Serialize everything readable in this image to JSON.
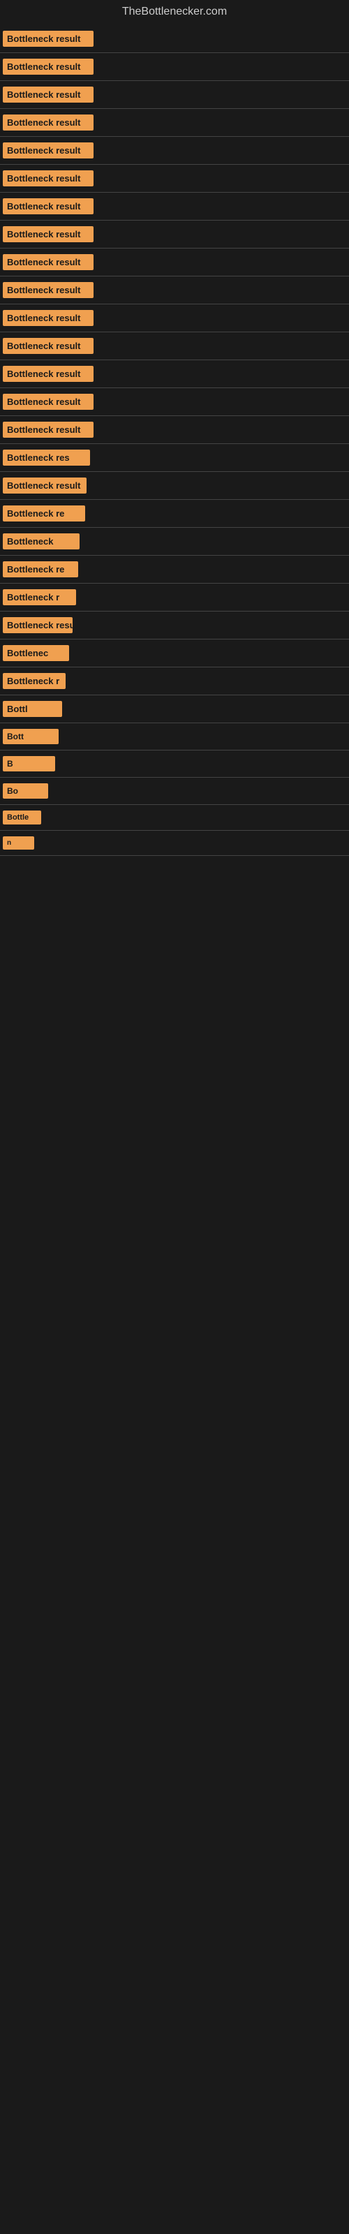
{
  "site": {
    "title": "TheBottlenecker.com"
  },
  "items": [
    {
      "id": 1,
      "label": "Bottleneck result",
      "width": 130
    },
    {
      "id": 2,
      "label": "Bottleneck result",
      "width": 130
    },
    {
      "id": 3,
      "label": "Bottleneck result",
      "width": 130
    },
    {
      "id": 4,
      "label": "Bottleneck result",
      "width": 130
    },
    {
      "id": 5,
      "label": "Bottleneck result",
      "width": 130
    },
    {
      "id": 6,
      "label": "Bottleneck result",
      "width": 130
    },
    {
      "id": 7,
      "label": "Bottleneck result",
      "width": 130
    },
    {
      "id": 8,
      "label": "Bottleneck result",
      "width": 130
    },
    {
      "id": 9,
      "label": "Bottleneck result",
      "width": 130
    },
    {
      "id": 10,
      "label": "Bottleneck result",
      "width": 130
    },
    {
      "id": 11,
      "label": "Bottleneck result",
      "width": 130
    },
    {
      "id": 12,
      "label": "Bottleneck result",
      "width": 130
    },
    {
      "id": 13,
      "label": "Bottleneck result",
      "width": 130
    },
    {
      "id": 14,
      "label": "Bottleneck result",
      "width": 130
    },
    {
      "id": 15,
      "label": "Bottleneck result",
      "width": 130
    },
    {
      "id": 16,
      "label": "Bottleneck res",
      "width": 125
    },
    {
      "id": 17,
      "label": "Bottleneck result",
      "width": 120
    },
    {
      "id": 18,
      "label": "Bottleneck re",
      "width": 118
    },
    {
      "id": 19,
      "label": "Bottleneck",
      "width": 110
    },
    {
      "id": 20,
      "label": "Bottleneck re",
      "width": 108
    },
    {
      "id": 21,
      "label": "Bottleneck r",
      "width": 105
    },
    {
      "id": 22,
      "label": "Bottleneck resu",
      "width": 100
    },
    {
      "id": 23,
      "label": "Bottlenec",
      "width": 95
    },
    {
      "id": 24,
      "label": "Bottleneck r",
      "width": 90
    },
    {
      "id": 25,
      "label": "Bottl",
      "width": 85
    },
    {
      "id": 26,
      "label": "Bott",
      "width": 80
    },
    {
      "id": 27,
      "label": "B",
      "width": 18
    },
    {
      "id": 28,
      "label": "Bo",
      "width": 40
    },
    {
      "id": 29,
      "label": "Bottle",
      "width": 60
    },
    {
      "id": 30,
      "label": "n",
      "width": 14
    }
  ],
  "colors": {
    "background": "#1a1a1a",
    "label_bg": "#f0a050",
    "label_text": "#1a1a1a",
    "title_text": "#cccccc",
    "separator": "#444444"
  }
}
